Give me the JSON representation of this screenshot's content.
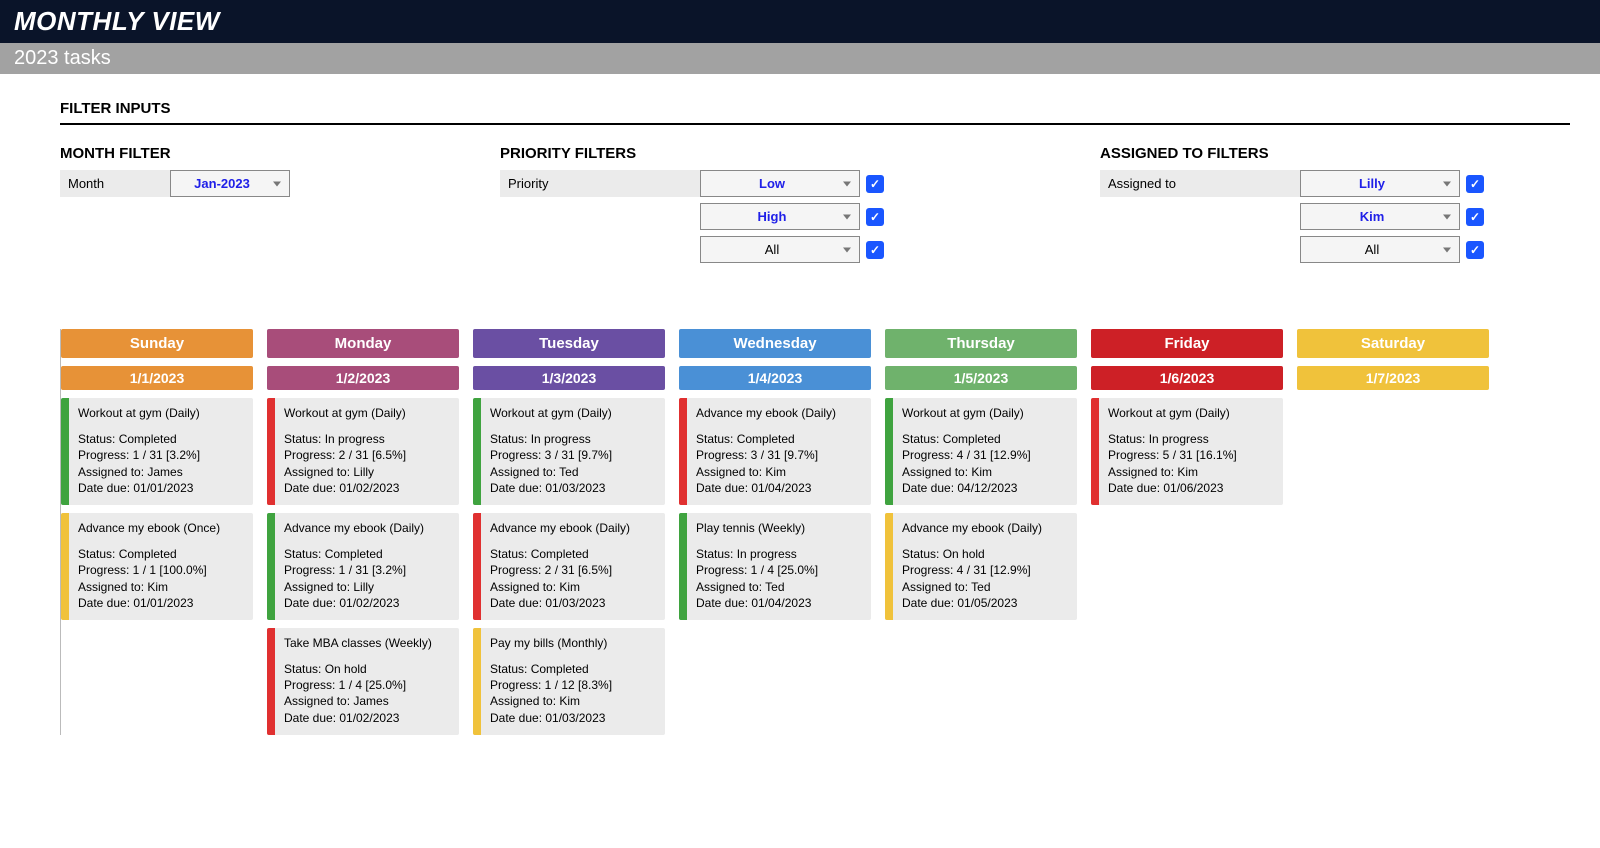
{
  "header": {
    "title": "MONTHLY VIEW",
    "subtitle": "2023 tasks"
  },
  "filters": {
    "section_title": "FILTER INPUTS",
    "month": {
      "group_title": "MONTH FILTER",
      "label": "Month",
      "value": "Jan-2023"
    },
    "priority": {
      "group_title": "PRIORITY FILTERS",
      "label": "Priority",
      "rows": [
        {
          "value": "Low",
          "plain": false,
          "checked": true
        },
        {
          "value": "High",
          "plain": false,
          "checked": true
        },
        {
          "value": "All",
          "plain": true,
          "checked": true
        }
      ]
    },
    "assigned": {
      "group_title": "ASSIGNED TO FILTERS",
      "label": "Assigned to",
      "rows": [
        {
          "value": "Lilly",
          "plain": false,
          "checked": true
        },
        {
          "value": "Kim",
          "plain": false,
          "checked": true
        },
        {
          "value": "All",
          "plain": true,
          "checked": true
        }
      ]
    }
  },
  "day_colors": {
    "Sunday": "#e79237",
    "Monday": "#a84d7a",
    "Tuesday": "#6a4fa3",
    "Wednesday": "#4a90d6",
    "Thursday": "#6fb26c",
    "Friday": "#cd2026",
    "Saturday": "#f0c23b"
  },
  "stripe_colors": {
    "green": "#3fa33f",
    "yellow": "#f0c23b",
    "red": "#e03030"
  },
  "days": [
    {
      "name": "Sunday",
      "date": "1/1/2023",
      "tasks": [
        {
          "stripe": "green",
          "title": "Workout at gym (Daily)",
          "status": "Completed",
          "progress": "1 / 31  [3.2%]",
          "assigned": "James",
          "due": "01/01/2023"
        },
        {
          "stripe": "yellow",
          "title": "Advance my ebook (Once)",
          "status": "Completed",
          "progress": "1 / 1  [100.0%]",
          "assigned": "Kim",
          "due": "01/01/2023"
        }
      ]
    },
    {
      "name": "Monday",
      "date": "1/2/2023",
      "tasks": [
        {
          "stripe": "red",
          "title": "Workout at gym (Daily)",
          "status": "In progress",
          "progress": "2 / 31  [6.5%]",
          "assigned": "Lilly",
          "due": "01/02/2023"
        },
        {
          "stripe": "green",
          "title": "Advance my ebook (Daily)",
          "status": "Completed",
          "progress": "1 / 31  [3.2%]",
          "assigned": "Lilly",
          "due": "01/02/2023"
        },
        {
          "stripe": "red",
          "title": "Take MBA classes (Weekly)",
          "status": "On hold",
          "progress": "1 / 4  [25.0%]",
          "assigned": "James",
          "due": "01/02/2023"
        }
      ]
    },
    {
      "name": "Tuesday",
      "date": "1/3/2023",
      "tasks": [
        {
          "stripe": "green",
          "title": "Workout at gym (Daily)",
          "status": "In progress",
          "progress": "3 / 31  [9.7%]",
          "assigned": "Ted",
          "due": "01/03/2023"
        },
        {
          "stripe": "red",
          "title": "Advance my ebook (Daily)",
          "status": "Completed",
          "progress": "2 / 31  [6.5%]",
          "assigned": "Kim",
          "due": "01/03/2023"
        },
        {
          "stripe": "yellow",
          "title": "Pay my bills (Monthly)",
          "status": "Completed",
          "progress": "1 / 12  [8.3%]",
          "assigned": "Kim",
          "due": "01/03/2023"
        }
      ]
    },
    {
      "name": "Wednesday",
      "date": "1/4/2023",
      "tasks": [
        {
          "stripe": "red",
          "title": "Advance my ebook (Daily)",
          "status": "Completed",
          "progress": "3 / 31  [9.7%]",
          "assigned": "Kim",
          "due": "01/04/2023"
        },
        {
          "stripe": "green",
          "title": "Play tennis (Weekly)",
          "status": "In progress",
          "progress": "1 / 4  [25.0%]",
          "assigned": "Ted",
          "due": "01/04/2023"
        }
      ]
    },
    {
      "name": "Thursday",
      "date": "1/5/2023",
      "tasks": [
        {
          "stripe": "green",
          "title": "Workout at gym (Daily)",
          "status": "Completed",
          "progress": "4 / 31  [12.9%]",
          "assigned": "Kim",
          "due": "04/12/2023"
        },
        {
          "stripe": "yellow",
          "title": "Advance my ebook (Daily)",
          "status": "On hold",
          "progress": "4 / 31  [12.9%]",
          "assigned": "Ted",
          "due": "01/05/2023"
        }
      ]
    },
    {
      "name": "Friday",
      "date": "1/6/2023",
      "tasks": [
        {
          "stripe": "red",
          "title": "Workout at gym (Daily)",
          "status": "In progress",
          "progress": "5 / 31  [16.1%]",
          "assigned": "Kim",
          "due": "01/06/2023"
        }
      ]
    },
    {
      "name": "Saturday",
      "date": "1/7/2023",
      "tasks": []
    }
  ],
  "labels": {
    "status": "Status: ",
    "progress": "Progress: ",
    "assigned": "Assigned to: ",
    "due": "Date due: "
  }
}
